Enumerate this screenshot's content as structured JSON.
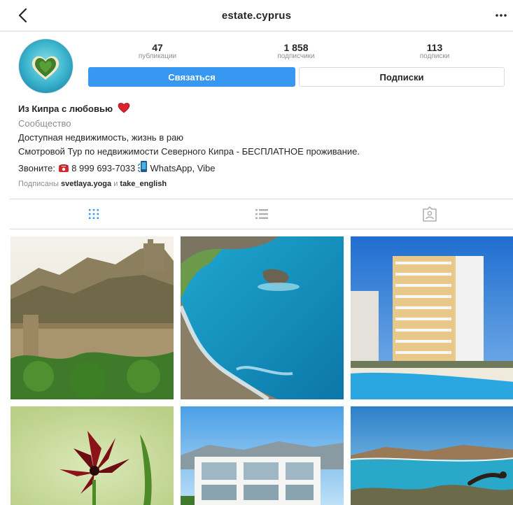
{
  "header": {
    "username": "estate.cyprus"
  },
  "stats": [
    {
      "value": "47",
      "label": "публикации"
    },
    {
      "value": "1 858",
      "label": "подписчики"
    },
    {
      "value": "113",
      "label": "подписки"
    }
  ],
  "buttons": {
    "contact": "Связаться",
    "following": "Подписки"
  },
  "bio": {
    "name": "Из Кипра с любовью",
    "category": "Сообщество",
    "line1": "Доступная недвижимость, жизнь в раю",
    "line2": "Смотровой Тур по недвижимости Северного Кипра - БЕСПЛАТНОЕ проживание.",
    "line3_prefix": "Звоните:",
    "phone": "8 999 693-7033",
    "messengers": "WhatsApp, Vibe",
    "followed_prefix": "Подписаны",
    "followed_user1": "svetlaya.yoga",
    "followed_and": "и",
    "followed_user2": "take_english"
  },
  "icons": {
    "back": "chevron-left-icon",
    "more": "more-icon",
    "heart": "red-heart-emoji",
    "phone": "telephone-emoji",
    "mobile": "mobile-phone-emoji",
    "tab_grid": "grid-icon",
    "tab_list": "list-icon",
    "tab_tagged": "tagged-icon"
  },
  "colors": {
    "accent": "#3897f0",
    "muted": "#8e8e8e",
    "border": "#dbdbdb"
  }
}
